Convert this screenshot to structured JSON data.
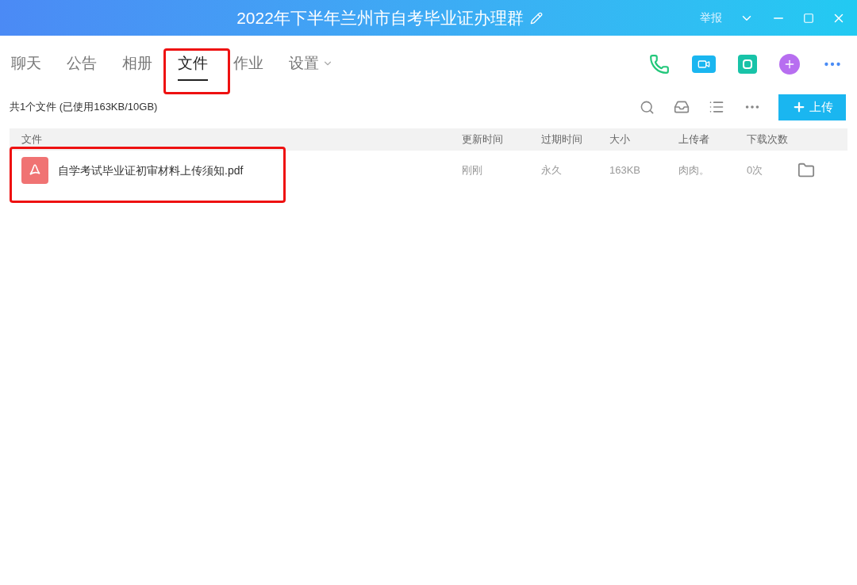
{
  "window": {
    "title": "2022年下半年兰州市自考毕业证办理群",
    "report": "举报"
  },
  "tabs": [
    {
      "label": "聊天",
      "selected": false,
      "dropdown": false
    },
    {
      "label": "公告",
      "selected": false,
      "dropdown": false
    },
    {
      "label": "相册",
      "selected": false,
      "dropdown": false
    },
    {
      "label": "文件",
      "selected": true,
      "dropdown": false
    },
    {
      "label": "作业",
      "selected": false,
      "dropdown": false
    },
    {
      "label": "设置",
      "selected": false,
      "dropdown": true
    }
  ],
  "summary": "共1个文件 (已使用163KB/10GB)",
  "upload_button": "上传",
  "table": {
    "columns": [
      "文件",
      "更新时间",
      "过期时间",
      "大小",
      "上传者",
      "下载次数"
    ],
    "rows": [
      {
        "name": "自学考试毕业证初审材料上传须知.pdf",
        "updated": "刚刚",
        "expires": "永久",
        "size": "163KB",
        "uploader": "肉肉。",
        "downloads": "0次"
      }
    ]
  }
}
